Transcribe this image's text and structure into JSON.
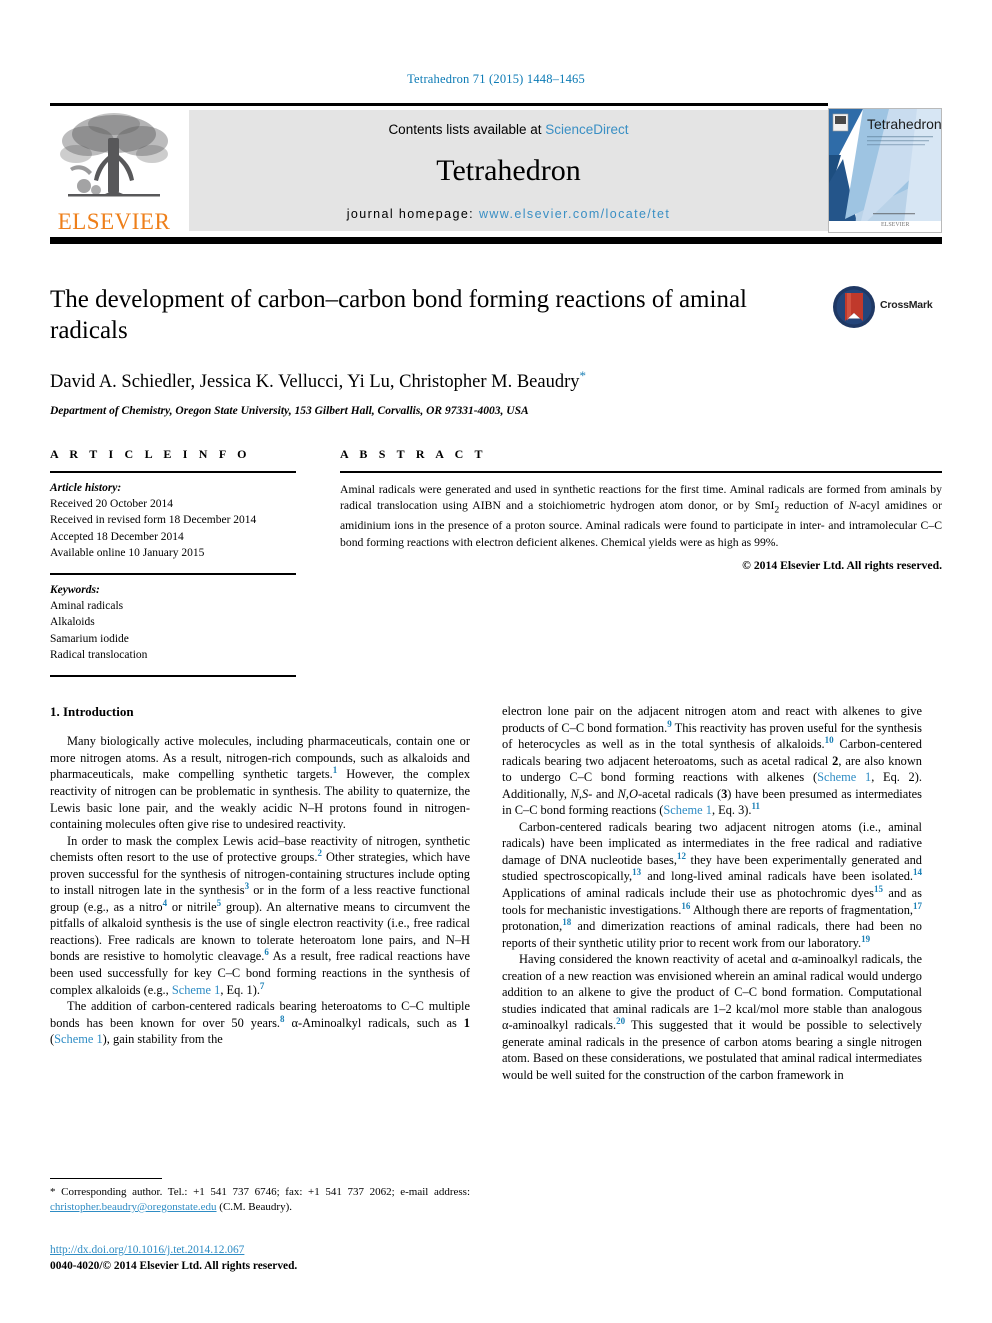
{
  "running_head": "Tetrahedron 71 (2015) 1448–1465",
  "masthead": {
    "publisher_name": "ELSEVIER",
    "contents_prefix": "Contents lists available at ",
    "contents_link": "ScienceDirect",
    "journal_title": "Tetrahedron",
    "homepage_prefix": "journal homepage: ",
    "homepage_url": "www.elsevier.com/locate/tet",
    "cover_title": "Tetrahedron",
    "cover_sub": "An international journal for the rapid publication of full original research papers and critical reviews in organic chemistry",
    "cover_footer": "ELSEVIER"
  },
  "article": {
    "title": "The development of carbon–carbon bond forming reactions of aminal radicals",
    "authors": "David A. Schiedler, Jessica K. Vellucci, Yi Lu, Christopher M. Beaudry",
    "corresponding_marker": "*",
    "affiliation": "Department of Chemistry, Oregon State University, 153 Gilbert Hall, Corvallis, OR 97331-4003, USA",
    "crossmark_label": "CrossMark"
  },
  "article_info": {
    "heading": "A R T I C L E   I N F O",
    "history_label": "Article history:",
    "history": [
      "Received 20 October 2014",
      "Received in revised form 18 December 2014",
      "Accepted 18 December 2014",
      "Available online 10 January 2015"
    ],
    "keywords_label": "Keywords:",
    "keywords": [
      "Aminal radicals",
      "Alkaloids",
      "Samarium iodide",
      "Radical translocation"
    ]
  },
  "abstract": {
    "heading": "A B S T R A C T",
    "text": "Aminal radicals were generated and used in synthetic reactions for the first time. Aminal radicals are formed from aminals by radical translocation using AIBN and a stoichiometric hydrogen atom donor, or by SmI2 reduction of N-acyl amidines or amidinium ions in the presence of a proton source. Aminal radicals were found to participate in inter- and intramolecular C–C bond forming reactions with electron deficient alkenes. Chemical yields were as high as 99%.",
    "copyright": "© 2014 Elsevier Ltd. All rights reserved."
  },
  "body": {
    "section_number_title": "1. Introduction",
    "left_paragraphs": [
      "Many biologically active molecules, including pharmaceuticals, contain one or more nitrogen atoms. As a result, nitrogen-rich compounds, such as alkaloids and pharmaceuticals, make compelling synthetic targets.1 However, the complex reactivity of nitrogen can be problematic in synthesis. The ability to quaternize, the Lewis basic lone pair, and the weakly acidic N–H protons found in nitrogen-containing molecules often give rise to undesired reactivity.",
      "In order to mask the complex Lewis acid–base reactivity of nitrogen, synthetic chemists often resort to the use of protective groups.2 Other strategies, which have proven successful for the synthesis of nitrogen-containing structures include opting to install nitrogen late in the synthesis3 or in the form of a less reactive functional group (e.g., as a nitro4 or nitrile5 group). An alternative means to circumvent the pitfalls of alkaloid synthesis is the use of single electron reactivity (i.e., free radical reactions). Free radicals are known to tolerate heteroatom lone pairs, and N–H bonds are resistive to homolytic cleavage.6 As a result, free radical reactions have been used successfully for key C–C bond forming reactions in the synthesis of complex alkaloids (e.g., Scheme 1, Eq. 1).7",
      "The addition of carbon-centered radicals bearing heteroatoms to C–C multiple bonds has been known for over 50 years.8 α-Aminoalkyl radicals, such as 1 (Scheme 1), gain stability from the"
    ],
    "right_paragraphs": [
      "electron lone pair on the adjacent nitrogen atom and react with alkenes to give products of C–C bond formation.9 This reactivity has proven useful for the synthesis of heterocycles as well as in the total synthesis of alkaloids.10 Carbon-centered radicals bearing two adjacent heteroatoms, such as acetal radical 2, are also known to undergo C–C bond forming reactions with alkenes (Scheme 1, Eq. 2). Additionally, N,S- and N,O-acetal radicals (3) have been presumed as intermediates in C–C bond forming reactions (Scheme 1, Eq. 3).11",
      "Carbon-centered radicals bearing two adjacent nitrogen atoms (i.e., aminal radicals) have been implicated as intermediates in the free radical and radiative damage of DNA nucleotide bases,12 they have been experimentally generated and studied spectroscopically,13 and long-lived aminal radicals have been isolated.14 Applications of aminal radicals include their use as photochromic dyes15 and as tools for mechanistic investigations.16 Although there are reports of fragmentation,17 protonation,18 and dimerization reactions of aminal radicals, there had been no reports of their synthetic utility prior to recent work from our laboratory.19",
      "Having considered the known reactivity of acetal and α-aminoalkyl radicals, the creation of a new reaction was envisioned wherein an aminal radical would undergo addition to an alkene to give the product of C–C bond formation. Computational studies indicated that aminal radicals are 1–2 kcal/mol more stable than analogous α-aminoalkyl radicals.20 This suggested that it would be possible to selectively generate aminal radicals in the presence of carbon atoms bearing a single nitrogen atom. Based on these considerations, we postulated that aminal radical intermediates would be well suited for the construction of the carbon framework in"
    ]
  },
  "footer": {
    "corresponding_note": "* Corresponding author. Tel.: +1 541 737 6746; fax: +1 541 737 2062; e-mail address: ",
    "email": "christopher.beaudry@oregonstate.edu",
    "email_suffix": " (C.M. Beaudry).",
    "doi": "http://dx.doi.org/10.1016/j.tet.2014.12.067",
    "issn_line": "0040-4020/© 2014 Elsevier Ltd. All rights reserved."
  },
  "colors": {
    "link_blue": "#2e8cc4",
    "header_blue": "#0b7ab5",
    "elsevier_orange": "#ee7f1a",
    "banner_grey": "#e4e4e4"
  }
}
